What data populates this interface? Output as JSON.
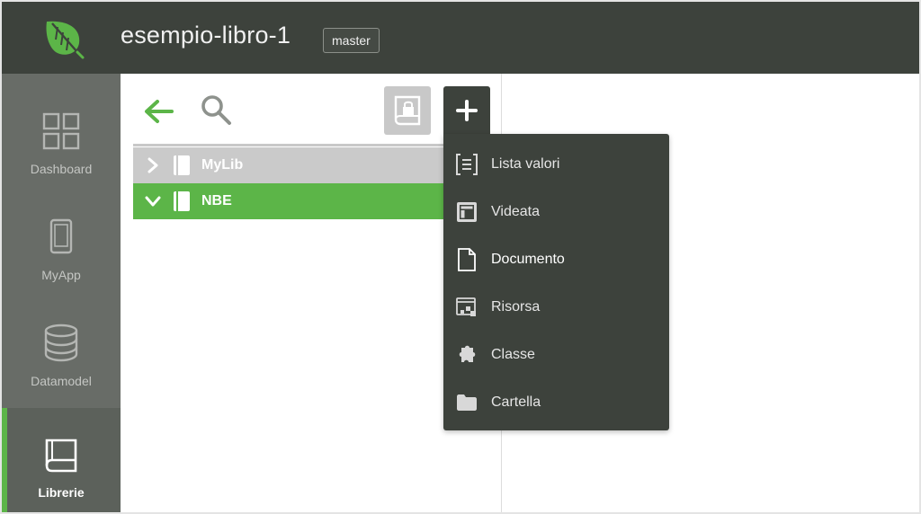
{
  "header": {
    "app_title": "esempio-libro-1",
    "branch": "master",
    "logo_icon": "leaf-logo"
  },
  "sidebar": {
    "items": [
      {
        "label": "Dashboard",
        "icon": "grid-icon",
        "active": false
      },
      {
        "label": "MyApp",
        "icon": "phone-icon",
        "active": false
      },
      {
        "label": "Datamodel",
        "icon": "database-icon",
        "active": false
      },
      {
        "label": "Librerie",
        "icon": "book-icon",
        "active": true
      }
    ]
  },
  "library_panel": {
    "toolbar": {
      "back_icon": "arrow-left-icon",
      "search_icon": "search-icon",
      "lock_icon": "locked-book-icon",
      "add_icon": "plus-icon"
    },
    "tree": [
      {
        "label": "MyLib",
        "expanded": false,
        "selected": false
      },
      {
        "label": "NBE",
        "expanded": true,
        "selected": true
      }
    ]
  },
  "add_menu": {
    "items": [
      {
        "label": "Lista valori",
        "icon": "value-list-icon"
      },
      {
        "label": "Videata",
        "icon": "form-icon"
      },
      {
        "label": "Documento",
        "icon": "document-icon"
      },
      {
        "label": "Risorsa",
        "icon": "resource-icon"
      },
      {
        "label": "Classe",
        "icon": "puzzle-icon"
      },
      {
        "label": "Cartella",
        "icon": "folder-icon"
      }
    ]
  },
  "colors": {
    "header_bg": "#3d423c",
    "sidebar_bg": "#686c67",
    "accent_green": "#5cb548",
    "tree_row_gray": "#cacaca",
    "menu_bg": "#3d423c"
  }
}
